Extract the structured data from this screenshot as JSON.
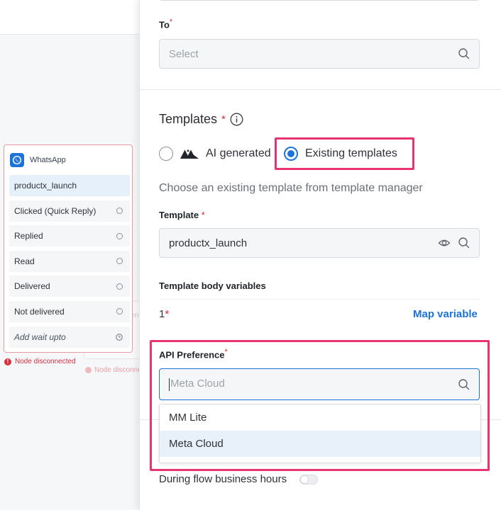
{
  "node": {
    "title": "WhatsApp",
    "items": [
      {
        "label": "productx_launch"
      },
      {
        "label": "Clicked (Quick Reply)"
      },
      {
        "label": "Replied"
      },
      {
        "label": "Read"
      },
      {
        "label": "Delivered"
      },
      {
        "label": "Not delivered"
      },
      {
        "label": "Add wait upto"
      }
    ],
    "status": "Node disconnected",
    "ghost_status": "Node disconne",
    "ghost_sliver": "ent"
  },
  "form": {
    "to": {
      "label": "To",
      "required_mark": "*",
      "placeholder": "Select"
    },
    "templates": {
      "title": "Templates",
      "required_mark": "*",
      "options": [
        {
          "label": "AI generated",
          "selected": false
        },
        {
          "label": "Existing templates",
          "selected": true
        }
      ],
      "helper": "Choose an existing template from template manager"
    },
    "template": {
      "label": "Template",
      "required_mark": "*",
      "value": "productx_launch"
    },
    "body_variables": {
      "label": "Template body variables",
      "variable": "1",
      "required_mark": "*",
      "action": "Map variable"
    },
    "api_preference": {
      "label": "API Preference",
      "required_mark": "*",
      "placeholder": "Meta Cloud",
      "options": [
        "MM Lite",
        "Meta Cloud"
      ],
      "highlighted_option": "Meta Cloud"
    },
    "business_hours": {
      "label": "During flow business hours",
      "enabled": false
    }
  },
  "colors": {
    "accent": "#1e73d8",
    "highlight_box": "#e8346f",
    "required": "#e0283a",
    "error": "#d6303f"
  },
  "icons": {
    "search": "search-icon",
    "preview": "eye-icon",
    "info": "info-icon",
    "whatsapp": "whatsapp-icon",
    "clock": "clock-icon",
    "ai_logo": "ai-logo-icon"
  }
}
